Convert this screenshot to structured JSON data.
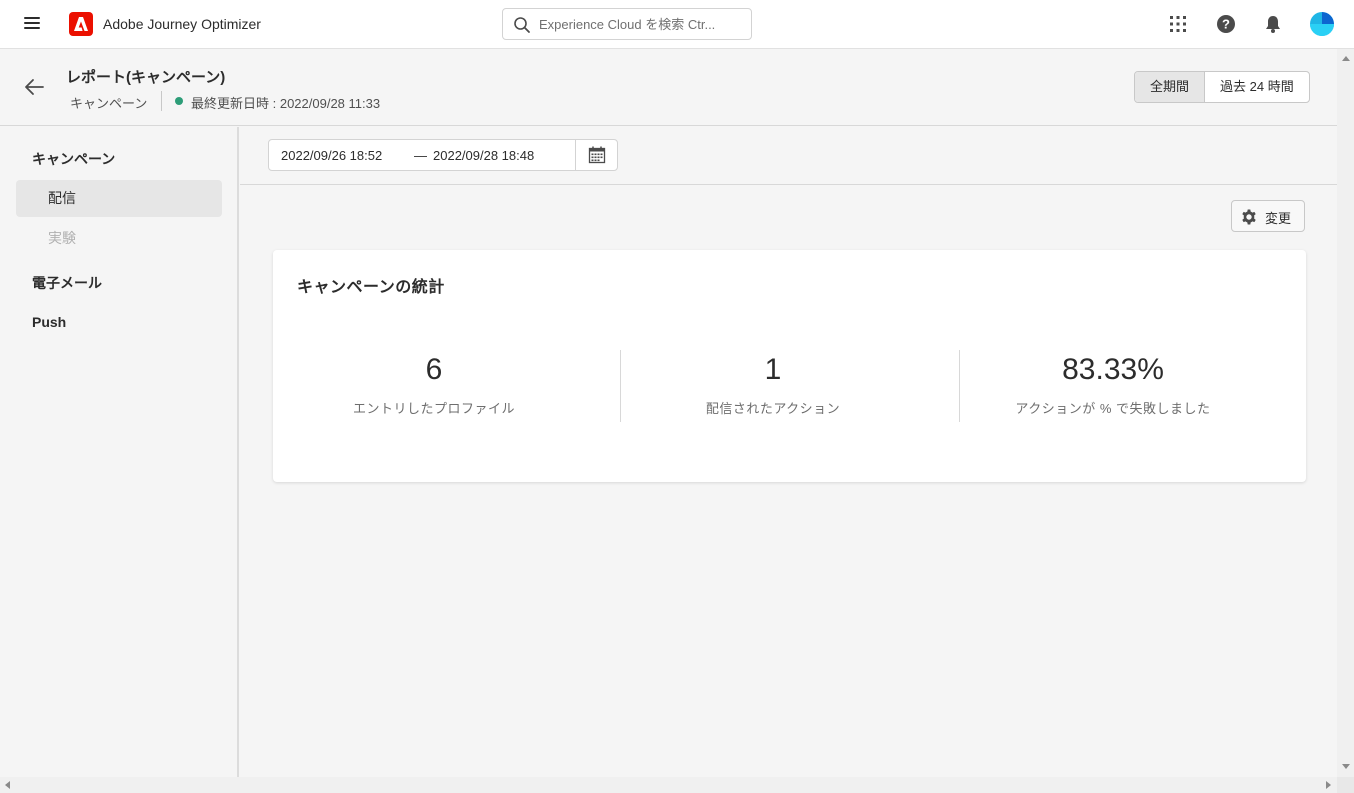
{
  "app": {
    "title": "Adobe Journey Optimizer",
    "brand_color": "#eb1000"
  },
  "search": {
    "placeholder": "Experience Cloud を検索 Ctr..."
  },
  "topbar_icons": [
    "apps-grid-icon",
    "help-icon",
    "bell-icon",
    "avatar"
  ],
  "header": {
    "title": "レポート(キャンペーン)",
    "breadcrumb": "キャンペーン",
    "status_color": "#2d9d78",
    "last_updated": "最終更新日時 : 2022/09/28 11:33",
    "range_options": [
      "全期間",
      "過去 24 時間"
    ],
    "range_selected": "全期間"
  },
  "sidebar": {
    "campaign_heading": "キャンペーン",
    "items": [
      {
        "label": "配信",
        "state": "selected"
      },
      {
        "label": "実験",
        "state": "disabled"
      }
    ],
    "email_heading": "電子メール",
    "push_heading": "Push"
  },
  "date_range": {
    "start": "2022/09/26 18:52",
    "separator": "—",
    "end": "2022/09/28 18:48"
  },
  "toolbar": {
    "change_label": "変更"
  },
  "stats_card": {
    "title": "キャンペーンの統計",
    "stats": [
      {
        "value": "6",
        "label": "エントリしたプロファイル"
      },
      {
        "value": "1",
        "label": "配信されたアクション"
      },
      {
        "value": "83.33%",
        "label": "アクションが % で失敗しました"
      }
    ]
  }
}
